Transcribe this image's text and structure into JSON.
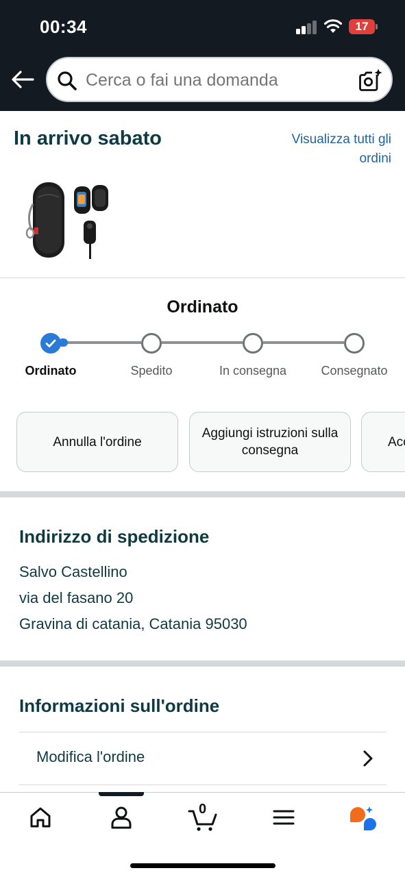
{
  "status_bar": {
    "time": "00:34",
    "battery": "17"
  },
  "search": {
    "placeholder": "Cerca o fai una domanda"
  },
  "arriving": {
    "title": "In arrivo sabato",
    "view_all": "Visualizza tutti gli ordini"
  },
  "tracker": {
    "title": "Ordinato",
    "steps": [
      {
        "label": "Ordinato",
        "done": true
      },
      {
        "label": "Spedito",
        "done": false
      },
      {
        "label": "In consegna",
        "done": false
      },
      {
        "label": "Consegnato",
        "done": false
      }
    ]
  },
  "actions": [
    {
      "label": "Annulla l'ordine"
    },
    {
      "label": "Aggiungi istruzioni sulla consegna"
    },
    {
      "label": "Acc"
    }
  ],
  "shipping": {
    "title": "Indirizzo di spedizione",
    "name": "Salvo Castellino",
    "street": "via del fasano 20",
    "city": "Gravina di catania, Catania 95030"
  },
  "order_info": {
    "title": "Informazioni sull'ordine",
    "rows": [
      {
        "label": "Modifica l'ordine"
      }
    ]
  },
  "bottom_nav": {
    "cart_count": "0",
    "items": [
      "home-icon",
      "account-icon",
      "cart-icon",
      "menu-icon",
      "rufus-assistant-icon"
    ]
  },
  "colors": {
    "header_bg": "#131a22",
    "link": "#2162a1",
    "progress_done": "#2a7bd8",
    "title_text": "#0f3a44",
    "battery_low": "#e0403b"
  }
}
